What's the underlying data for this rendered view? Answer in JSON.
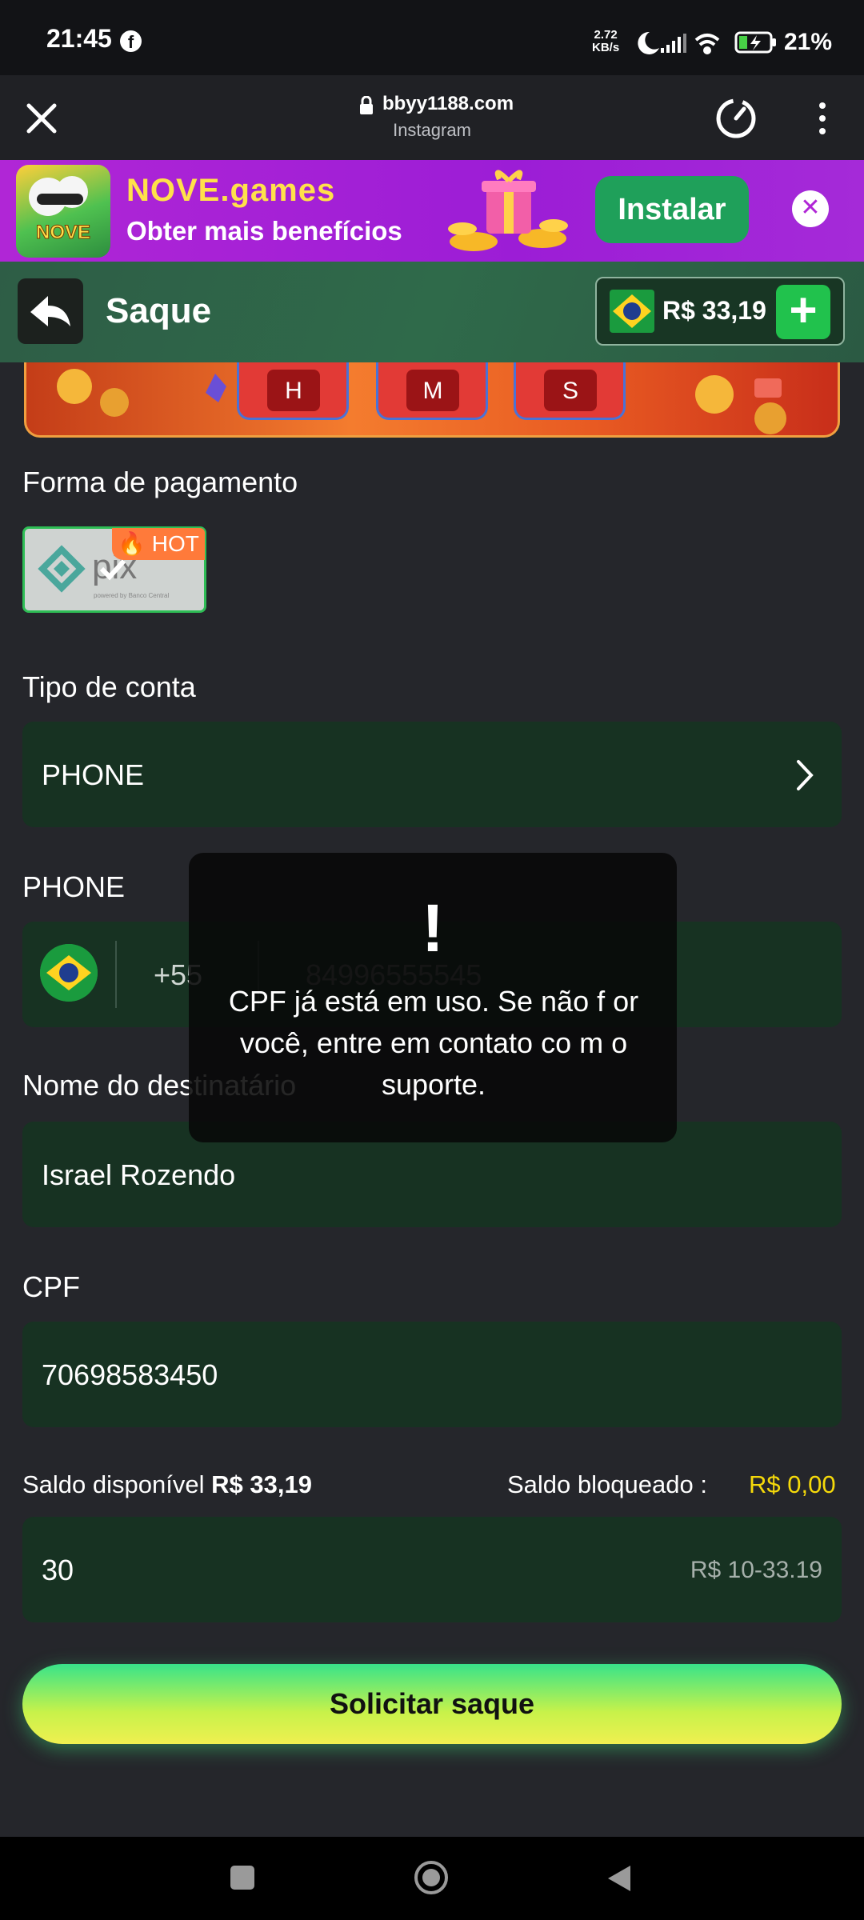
{
  "status_bar": {
    "time": "21:45",
    "speed_value": "2.72",
    "speed_unit": "KB/s",
    "battery": "21%"
  },
  "browser": {
    "url": "bbyy1188.com",
    "source": "Instagram"
  },
  "promo": {
    "title": "NOVE.games",
    "subtitle": "Obter mais benefícios",
    "install_label": "Instalar",
    "logo_text": "NOVE GAMES"
  },
  "header": {
    "title": "Saque",
    "balance": "R$ 33,19"
  },
  "countdown": {
    "labels": [
      "H",
      "M",
      "S"
    ]
  },
  "payment": {
    "label": "Forma de pagamento",
    "method": "pix",
    "badge": "HOT",
    "powered": "powered by Banco Central"
  },
  "account_type": {
    "label": "Tipo de conta",
    "value": "PHONE"
  },
  "phone": {
    "label": "PHONE",
    "country_code": "+55",
    "placeholder": "84996555545"
  },
  "recipient": {
    "label": "Nome do destinatário",
    "value": "Israel Rozendo"
  },
  "cpf": {
    "label": "CPF",
    "value": "70698583450"
  },
  "balances": {
    "available_label": "Saldo disponível",
    "available_value": "R$ 33,19",
    "blocked_label": "Saldo bloqueado :",
    "blocked_value": "R$ 0,00"
  },
  "amount": {
    "value": "30",
    "range_hint": "R$ 10-33.19"
  },
  "submit_label": "Solicitar saque",
  "toast": {
    "icon": "!",
    "message": "CPF já está em uso. Se não f or você, entre em contato co m o suporte."
  },
  "colors": {
    "accent_green": "#21c24d",
    "field_bg": "#173222",
    "warning_yellow": "#f5d90a"
  }
}
